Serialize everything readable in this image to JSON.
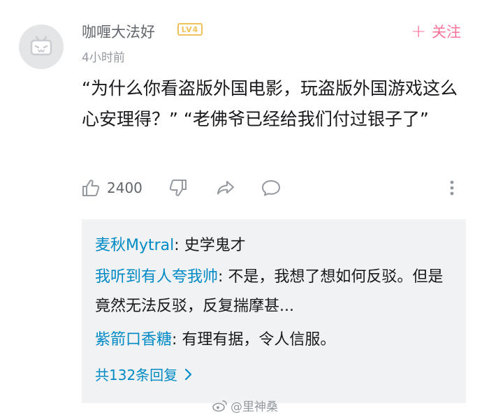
{
  "comment": {
    "username": "咖喱大法好",
    "level_badge": "LV4",
    "follow_label": "关注",
    "time": "4小时前",
    "text": "“为什么你看盗版外国电影，玩盗版外国游戏这么心安理得？”   “老佛爷已经给我们付过银子了”",
    "like_count": "2400"
  },
  "replies": {
    "items": [
      {
        "nick": "麦秋Mytral",
        "text": "史学鬼才"
      },
      {
        "nick": "我听到有人夸我帅",
        "text": "不是，我想了想如何反驳。但是竟然无法反驳，反复揣摩甚..."
      },
      {
        "nick": "紫箭口香糖",
        "text": "有理有据，令人信服。"
      }
    ],
    "more_label": "共132条回复"
  },
  "watermark": "@里神桑",
  "colors": {
    "accent_pink": "#fb7299",
    "link_blue": "#008ac5",
    "level_gold": "#f0c25a"
  }
}
